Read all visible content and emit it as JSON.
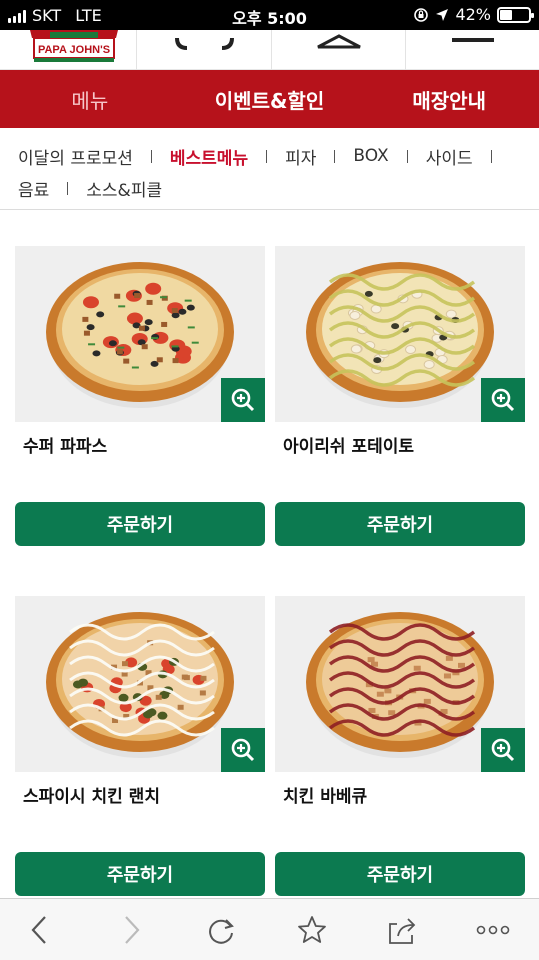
{
  "status_bar": {
    "carrier": "SKT",
    "network": "LTE",
    "time": "오후 5:00",
    "battery_percent": "42%",
    "battery_level": 0.42
  },
  "header": {
    "logo_alt": "PAPA JOHN'S",
    "icons": [
      "location-icon",
      "hanger-icon",
      "menu-icon"
    ]
  },
  "main_nav": {
    "items": [
      {
        "label": "메뉴",
        "active": true
      },
      {
        "label": "이벤트&할인",
        "active": false
      },
      {
        "label": "매장안내",
        "active": false
      }
    ]
  },
  "categories": {
    "row1": [
      "이달의 프로모션",
      "베스트메뉴",
      "피자",
      "BOX",
      "사이드"
    ],
    "row2": [
      "음료",
      "소스&피클"
    ],
    "active": "베스트메뉴"
  },
  "products": [
    {
      "name": "수퍼 파파스",
      "order_label": "주문하기",
      "topping": "supreme"
    },
    {
      "name": "아이리쉬 포테이토",
      "order_label": "주문하기",
      "topping": "potato"
    },
    {
      "name": "스파이시 치킨 랜치",
      "order_label": "주문하기",
      "topping": "ranch"
    },
    {
      "name": "치킨 바베큐",
      "order_label": "주문하기",
      "topping": "bbq"
    }
  ],
  "colors": {
    "brand_red": "#b6121b",
    "green": "#0c7a50",
    "active_category": "#c8102e"
  },
  "toolbar": {
    "icons": [
      "back-icon",
      "forward-icon",
      "reload-icon",
      "bookmark-icon",
      "share-icon",
      "more-icon"
    ]
  }
}
